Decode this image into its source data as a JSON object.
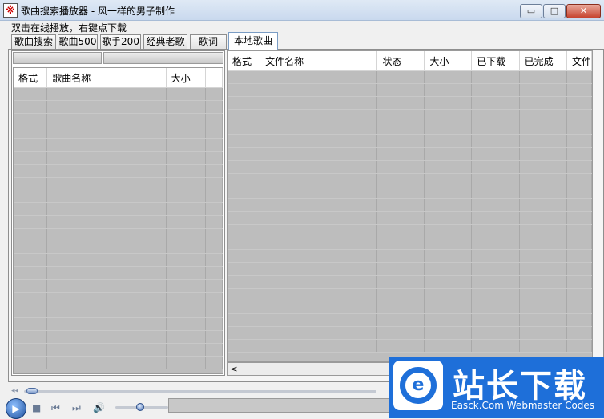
{
  "window": {
    "title": "歌曲搜索播放器  - 风一样的男子制作",
    "icon_glyph": "※",
    "minimize": "▭",
    "maximize": "□",
    "close": "✕"
  },
  "hint": "双击在线播放，右键点下载",
  "tabs": [
    {
      "label": "歌曲搜索"
    },
    {
      "label": "歌曲500"
    },
    {
      "label": "歌手200"
    },
    {
      "label": "经典老歌"
    },
    {
      "label": "歌词"
    },
    {
      "label": "本地歌曲",
      "active": true
    }
  ],
  "left_table": {
    "columns": [
      "格式",
      "歌曲名称",
      "大小",
      ""
    ]
  },
  "right_table": {
    "columns": [
      "格式",
      "文件名称",
      "状态",
      "大小",
      "已下载",
      "已完成",
      "文件"
    ]
  },
  "scroll": {
    "left_arrow": "<"
  },
  "player": {
    "seek_icon": "◂◂",
    "play": "▶",
    "stop": "■",
    "prev": "⏮",
    "next": "⏭",
    "volume": "🔊"
  },
  "watermark": {
    "logo_glyph": "e",
    "title": "站长下载",
    "subtitle": "Easck.Com Webmaster Codes"
  },
  "colors": {
    "accent": "#1e6fd9",
    "grid_fill": "#bdbdbd"
  }
}
